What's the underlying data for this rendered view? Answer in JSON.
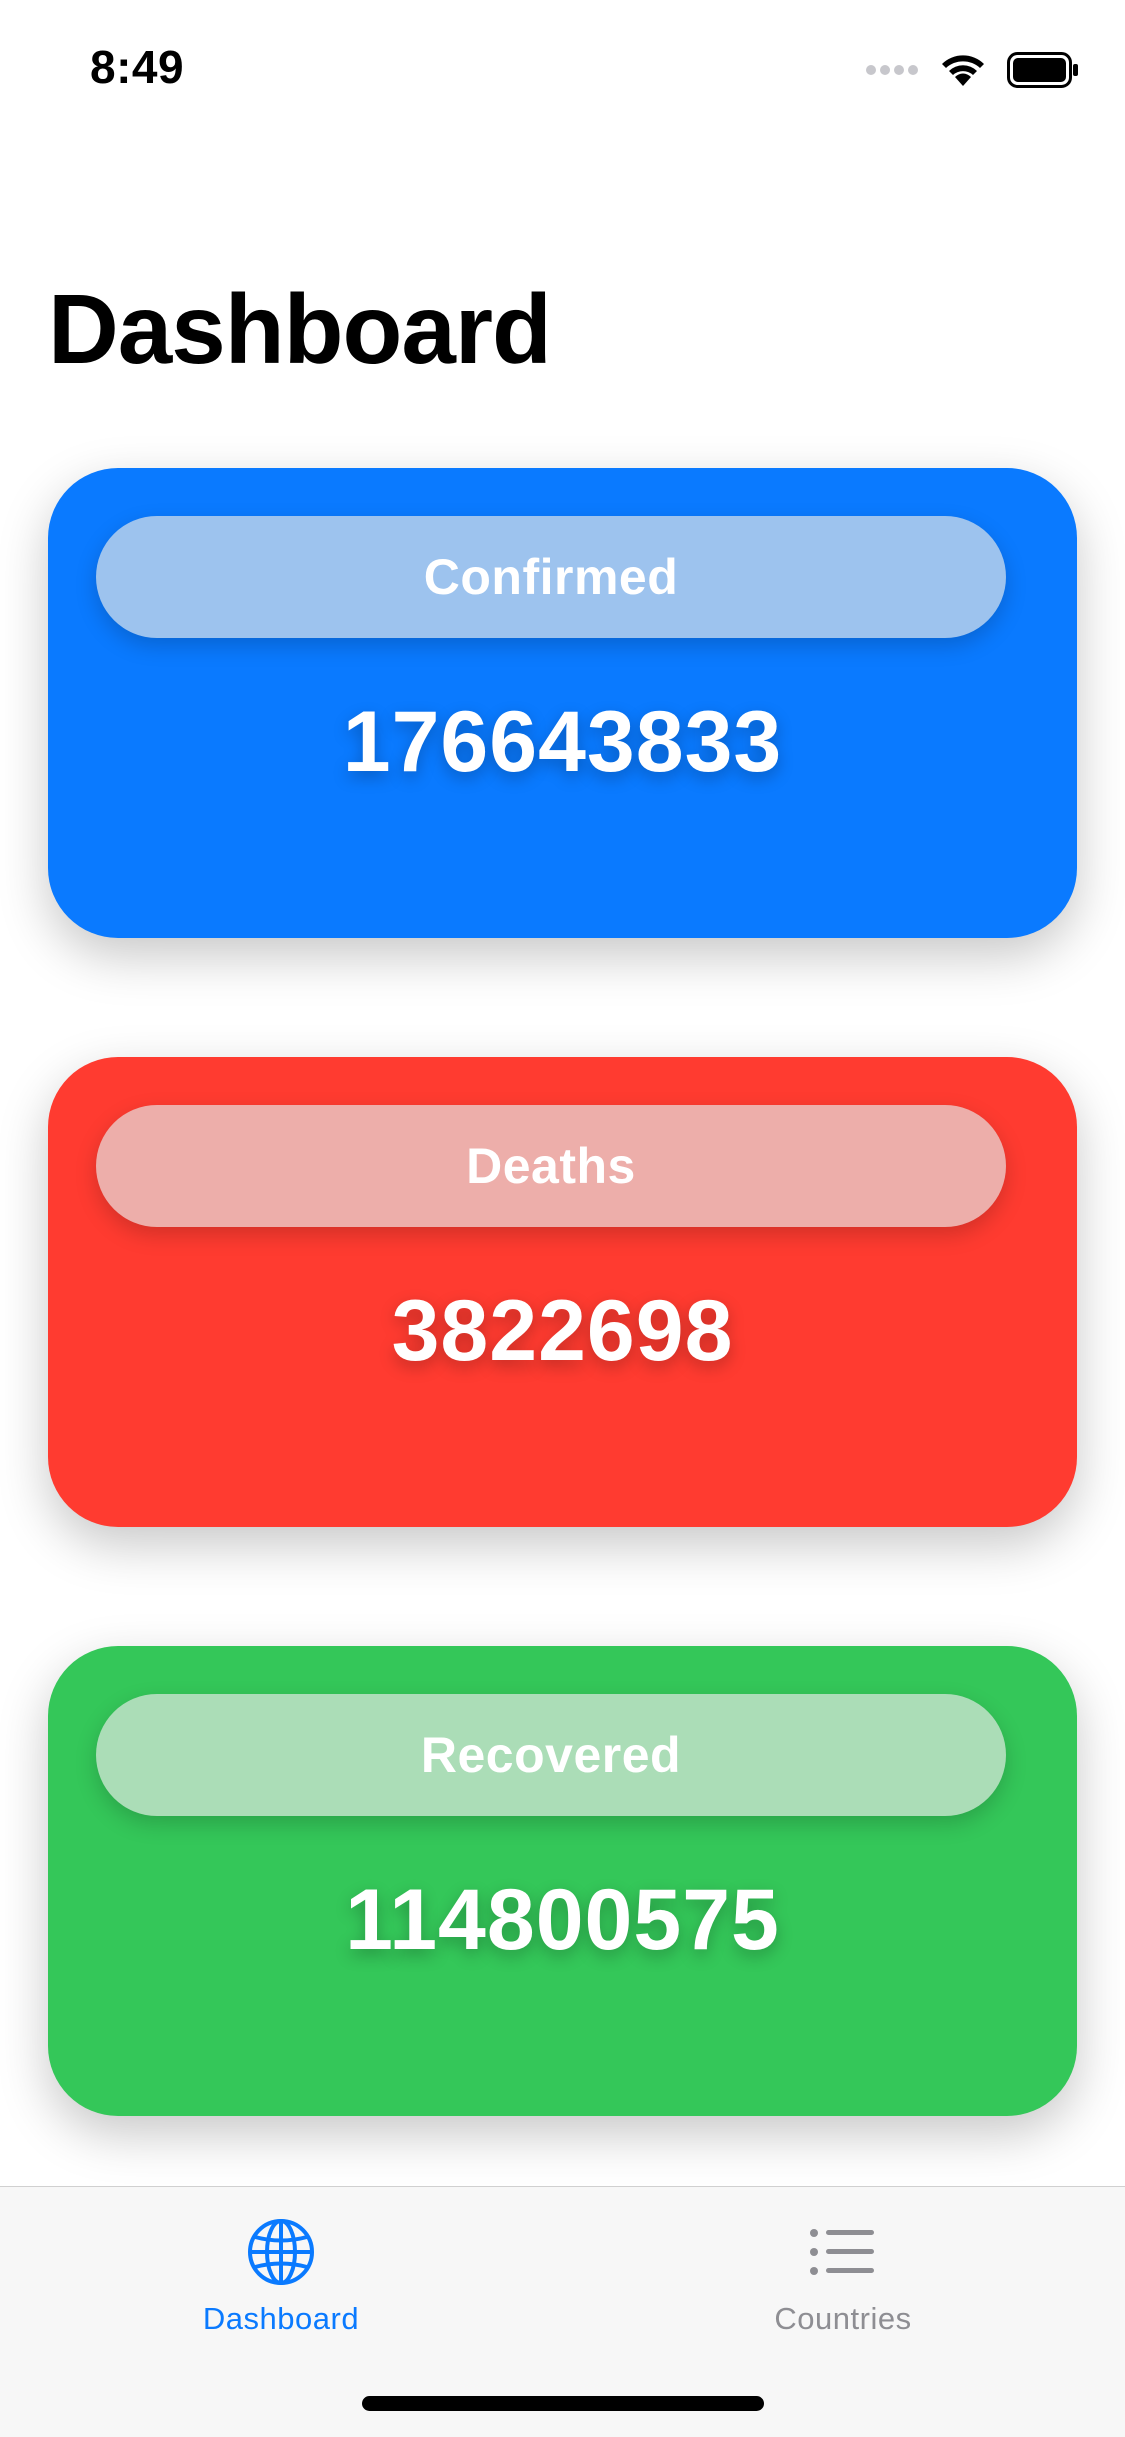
{
  "status_bar": {
    "time": "8:49"
  },
  "page": {
    "title": "Dashboard"
  },
  "cards": [
    {
      "label": "Confirmed",
      "value": "176643833",
      "color": "#0A7AFF",
      "pill_color": "#9DC3EE"
    },
    {
      "label": "Deaths",
      "value": "3822698",
      "color": "#FF3B30",
      "pill_color": "#EDAEAA"
    },
    {
      "label": "Recovered",
      "value": "114800575",
      "color": "#34C759",
      "pill_color": "#ABDDB7"
    }
  ],
  "tab_bar": {
    "items": [
      {
        "label": "Dashboard",
        "icon": "globe-icon",
        "active": true,
        "color": "#0A7AFF"
      },
      {
        "label": "Countries",
        "icon": "list-icon",
        "active": false,
        "color": "#8E8E93"
      }
    ]
  }
}
